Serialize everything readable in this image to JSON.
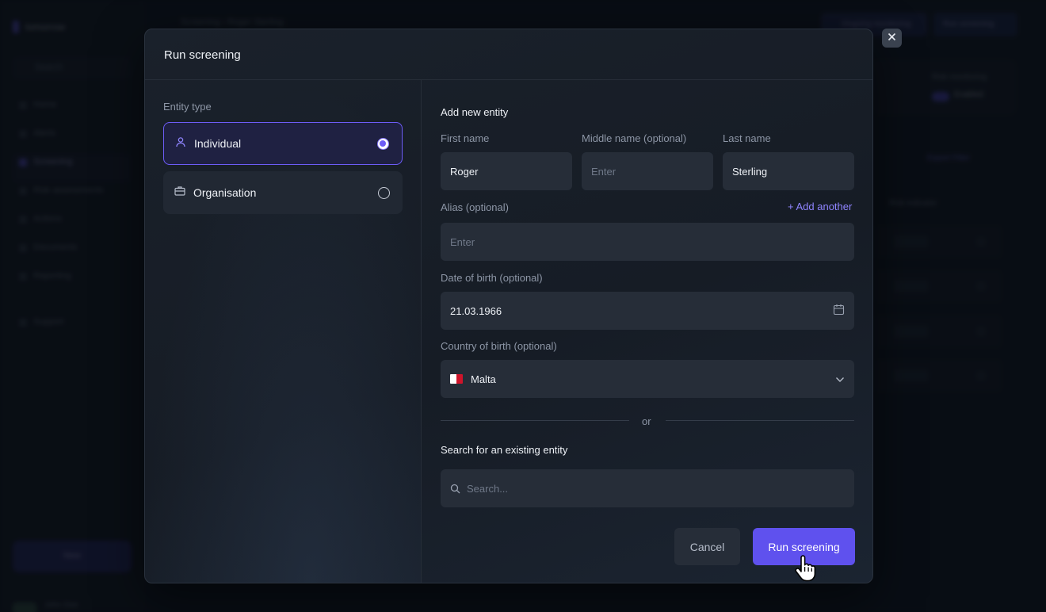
{
  "background_app": {
    "brand": "tomorrow",
    "search_placeholder": "Search",
    "nav": [
      "Home",
      "Alerts",
      "Screening",
      "Risk assessments",
      "Actions",
      "Documents",
      "Reporting"
    ],
    "support": "Support",
    "new_button": "New",
    "breadcrumbs": "Screening  ›  Roger Sterling",
    "top_button_1": "Ongoing monitoring",
    "top_button_2": "Run screening",
    "card_label": "Risk monitoring",
    "card_value": "Enabled",
    "links": "Export     Filter",
    "column_header": "Risk indicator",
    "user": "John Doe"
  },
  "modal": {
    "title": "Run screening",
    "entity_type_label": "Entity type",
    "entity_options": [
      {
        "label": "Individual",
        "selected": true,
        "icon": "person-icon"
      },
      {
        "label": "Organisation",
        "selected": false,
        "icon": "briefcase-icon"
      }
    ],
    "add_new_entity": "Add new entity",
    "fields": {
      "first_name": {
        "label": "First name",
        "value": "Roger",
        "placeholder": "Enter"
      },
      "middle_name": {
        "label": "Middle name (optional)",
        "value": "",
        "placeholder": "Enter"
      },
      "last_name": {
        "label": "Last name",
        "value": "Sterling",
        "placeholder": "Enter"
      },
      "alias": {
        "label": "Alias (optional)",
        "value": "",
        "placeholder": "Enter"
      },
      "add_another": "+ Add another",
      "dob": {
        "label": "Date of birth (optional)",
        "value": "21.03.1966"
      },
      "country": {
        "label": "Country of birth (optional)",
        "value": "Malta"
      }
    },
    "divider_text": "or",
    "search_existing_heading": "Search for an existing entity",
    "search_placeholder": "Search...",
    "cancel_label": "Cancel",
    "run_label": "Run screening"
  },
  "colors": {
    "accent": "#5f51ee",
    "accent_border": "#6d5cf7",
    "link": "#8f84ff",
    "modal_bg": "#1a212b",
    "input_bg": "#262d38"
  }
}
